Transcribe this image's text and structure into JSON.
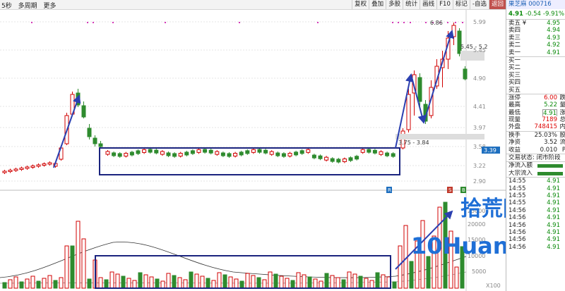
{
  "toolbar": {
    "left": [
      "5秒",
      "多周期",
      "更多"
    ],
    "buttons": [
      "复权",
      "叠加",
      "多股",
      "统计",
      "画线",
      "F10",
      "标记",
      "-自选",
      "返回"
    ]
  },
  "stock": {
    "name": "果芝麻",
    "code": "000716",
    "price": "4.91",
    "change": "-0.54",
    "pct": "-9.91%"
  },
  "order_book": {
    "sell": [
      {
        "label": "卖五 ¥",
        "price": "4.95"
      },
      {
        "label": "卖四",
        "price": "4.94"
      },
      {
        "label": "卖三",
        "price": "4.93"
      },
      {
        "label": "卖二",
        "price": "4.92"
      },
      {
        "label": "卖一",
        "price": "4.91"
      }
    ],
    "buy": [
      {
        "label": "买一",
        "price": ""
      },
      {
        "label": "买二",
        "price": ""
      },
      {
        "label": "买三",
        "price": ""
      },
      {
        "label": "买四",
        "price": ""
      },
      {
        "label": "买五",
        "price": ""
      }
    ]
  },
  "stats": [
    {
      "label": "涨停",
      "value": "6.00",
      "extra": "跌"
    },
    {
      "label": "最高",
      "value": "5.22",
      "extra": "量"
    },
    {
      "label": "最低",
      "value": "4.91",
      "extra": "涨"
    },
    {
      "label": "现量",
      "value": "7189",
      "extra": "总"
    },
    {
      "label": "外盘",
      "value": "748415",
      "extra": "内"
    },
    {
      "label": "换手",
      "value": "25.03%",
      "extra": "股"
    },
    {
      "label": "净资",
      "value": "3.52",
      "extra": "流"
    },
    {
      "label": "收益",
      "value": "0.010",
      "extra": "P"
    }
  ],
  "trade_status": "交易状态: 闭市阶段",
  "flows": [
    {
      "label": "净流入额"
    },
    {
      "label": "大宗流入"
    }
  ],
  "ticks": [
    {
      "time": "14:55",
      "price": "4.91"
    },
    {
      "time": "14:55",
      "price": "4.91"
    },
    {
      "time": "14:55",
      "price": "4.91"
    },
    {
      "time": "14:55",
      "price": "4.91"
    },
    {
      "time": "14:56",
      "price": "4.91"
    },
    {
      "time": "14:56",
      "price": "4.91"
    },
    {
      "time": "14:56",
      "price": "4.91"
    },
    {
      "time": "14:56",
      "price": "4.91"
    },
    {
      "time": "14:56",
      "price": "4.91"
    },
    {
      "time": "14:56",
      "price": "4.91"
    }
  ],
  "price_axis": [
    "5.99",
    "5.45",
    "4.90",
    "4.41",
    "3.97",
    "3.58",
    "3.22",
    "2.90"
  ],
  "vol_axis": [
    "25000",
    "20000",
    "15000",
    "10000",
    "5000",
    "X100"
  ],
  "annotations": {
    "high": "6.86",
    "zone_upper": "5.45 - 5.2",
    "zone_lower": "3.75 - 3.84",
    "current_tag": "3.39"
  },
  "markers": [
    "R",
    "S",
    "B"
  ],
  "watermark": {
    "top": "拾荒网",
    "bottom": "10Huang.CN"
  },
  "colors": {
    "up": "#d00000",
    "down": "#2e8b2e",
    "box": "#1a237e",
    "arrow": "#2b3fb0"
  }
}
